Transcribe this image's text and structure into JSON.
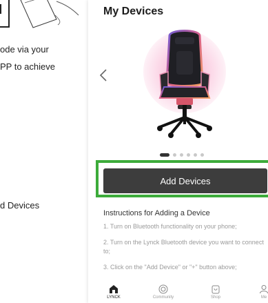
{
  "left_panel": {
    "line1": "ode  via your",
    "line2": "PP to achieve",
    "line3": "d Devices"
  },
  "screen": {
    "title": "My Devices",
    "carousel": {
      "total": 6,
      "active": 0
    },
    "add_button_label": "Add Devices",
    "instructions": {
      "title": "Instructions for Adding a Device",
      "steps": [
        "1. Turn on Bluetooth functionality on your phone;",
        "2. Turn on the Lynck Bluetooth device you want to connect to;",
        "3. Click on the \"Add Device\" or \"+\" button above;"
      ]
    },
    "tabs": [
      {
        "label": "LYNCK",
        "icon": "home-icon",
        "active": true
      },
      {
        "label": "Community",
        "icon": "compass-icon",
        "active": false
      },
      {
        "label": "Shop",
        "icon": "shopping-bag-icon",
        "active": false
      },
      {
        "label": "Me",
        "icon": "user-icon",
        "active": false
      }
    ]
  },
  "colors": {
    "highlight": "#3cab3a",
    "button": "#3d3d3d",
    "muted_text": "#9a9a9a"
  }
}
